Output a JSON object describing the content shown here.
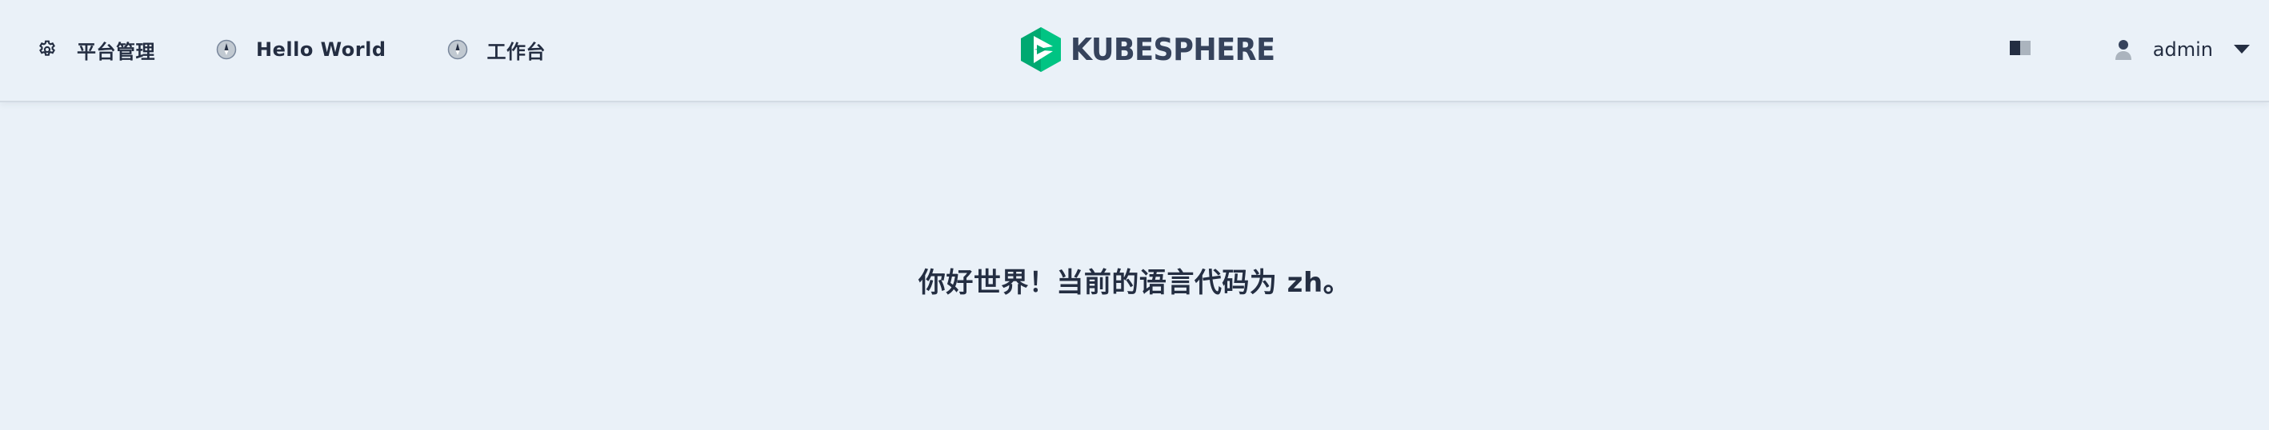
{
  "header": {
    "nav": [
      {
        "label": "平台管理",
        "icon": "gear-icon"
      },
      {
        "label": "Hello World",
        "icon": "compass-icon"
      },
      {
        "label": "工作台",
        "icon": "compass-icon"
      }
    ],
    "logo_text": "KUBESPHERE",
    "docs_icon": "book-icon",
    "user": {
      "name": "admin",
      "icon": "user-icon",
      "caret": "caret-down-icon"
    }
  },
  "main": {
    "greeting": "你好世界！当前的语言代码为 zh。"
  },
  "colors": {
    "background": "#eaf1f8",
    "text": "#242e42",
    "brand_green": "#00a971"
  }
}
